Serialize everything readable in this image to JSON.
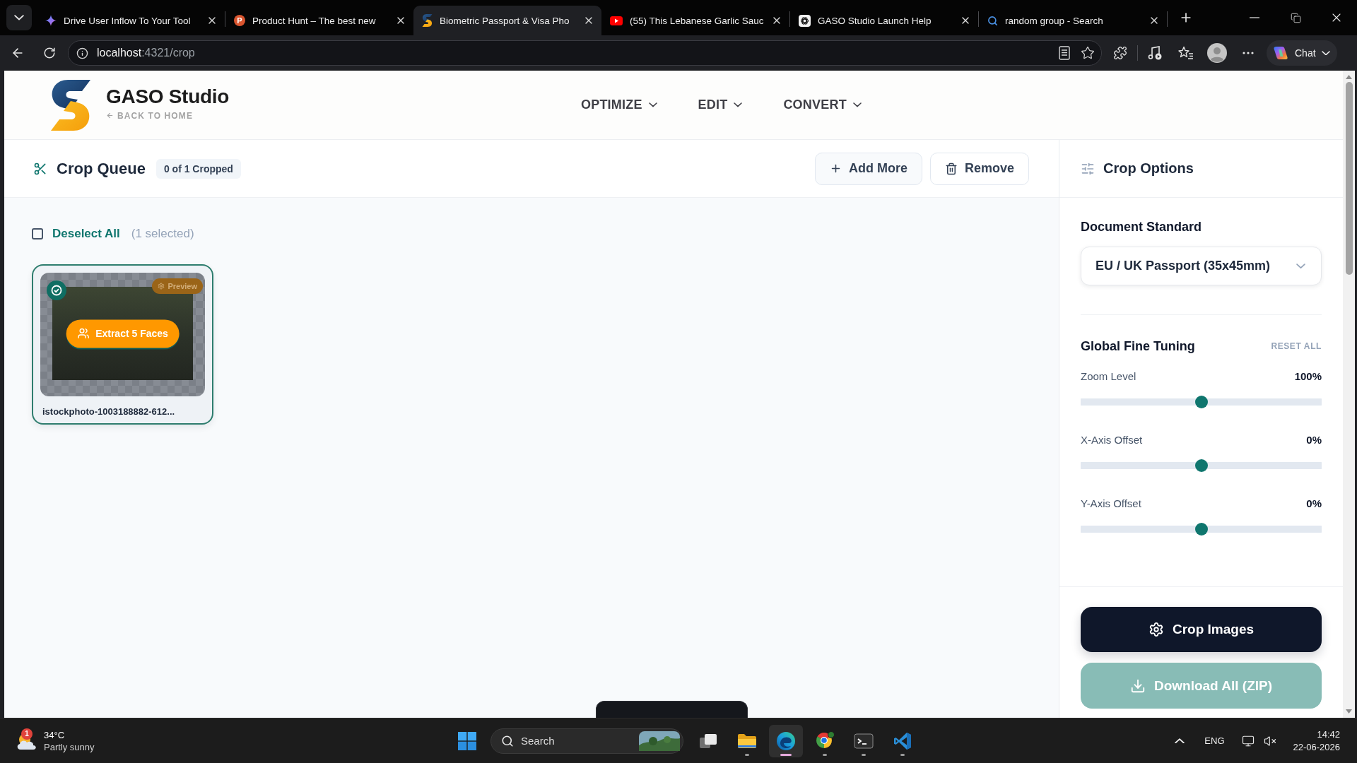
{
  "browser": {
    "tabs": [
      {
        "title": "Drive User Inflow To Your Tool",
        "kind": "sparkle",
        "selected": false
      },
      {
        "title": "Product Hunt – The best new",
        "kind": "lettermark",
        "favicon_text": "P",
        "selected": false
      },
      {
        "title": "Biometric Passport & Visa Pho",
        "kind": "gaso",
        "selected": true
      },
      {
        "title": "(55) This Lebanese Garlic Sauc",
        "kind": "video",
        "selected": false
      },
      {
        "title": "GASO Studio Launch Help",
        "kind": "chat",
        "selected": false
      },
      {
        "title": "random group - Search",
        "kind": "search",
        "selected": false
      }
    ],
    "address": {
      "host": "localhost",
      "path": ":4321/crop"
    },
    "chat_label": "Chat"
  },
  "header": {
    "brand": "GASO Studio",
    "back_link": "BACK TO HOME",
    "nav": [
      {
        "label": "OPTIMIZE"
      },
      {
        "label": "EDIT"
      },
      {
        "label": "CONVERT"
      }
    ]
  },
  "queue": {
    "title": "Crop Queue",
    "status": "0 of 1 Cropped",
    "actions": [
      {
        "label": "Add More",
        "kind": "add"
      },
      {
        "label": "Remove",
        "kind": "remove"
      }
    ],
    "select_all": {
      "label": "Deselect All",
      "checked": false,
      "count": "(1 selected)"
    },
    "items": [
      {
        "filename": "istockphoto-1003188882-612...",
        "selected": true,
        "preview": "Preview",
        "extract": "Extract 5 Faces"
      }
    ]
  },
  "options": {
    "title": "Crop Options",
    "document_standard": {
      "label": "Document Standard",
      "value": "EU / UK Passport (35x45mm)"
    },
    "fine_tuning": {
      "title": "Global Fine Tuning",
      "reset": "RESET ALL",
      "sliders": [
        {
          "label": "Zoom Level",
          "reading": "100%",
          "level": 0.5
        },
        {
          "label": "X-Axis Offset",
          "reading": "0%",
          "level": 0.5
        },
        {
          "label": "Y-Axis Offset",
          "reading": "0%",
          "level": 0.5
        }
      ]
    },
    "crop_button": "Crop Images",
    "download": {
      "label": "Download All (ZIP)",
      "disabled": true
    }
  },
  "taskbar": {
    "weather": {
      "temperature": "34°C",
      "condition": "Partly sunny",
      "badge": "1"
    },
    "search": "Search",
    "apps": [
      {
        "kind": "taskview",
        "running": false,
        "selected": false
      },
      {
        "kind": "files",
        "running": true,
        "selected": false
      },
      {
        "kind": "edge",
        "running": true,
        "selected": true
      },
      {
        "kind": "chrome",
        "running": true,
        "selected": false
      },
      {
        "kind": "terminal",
        "running": true,
        "selected": false
      },
      {
        "kind": "vscode",
        "running": true,
        "selected": false
      }
    ],
    "language": "ENG",
    "time": "14:42",
    "date": "22-06-2026"
  }
}
